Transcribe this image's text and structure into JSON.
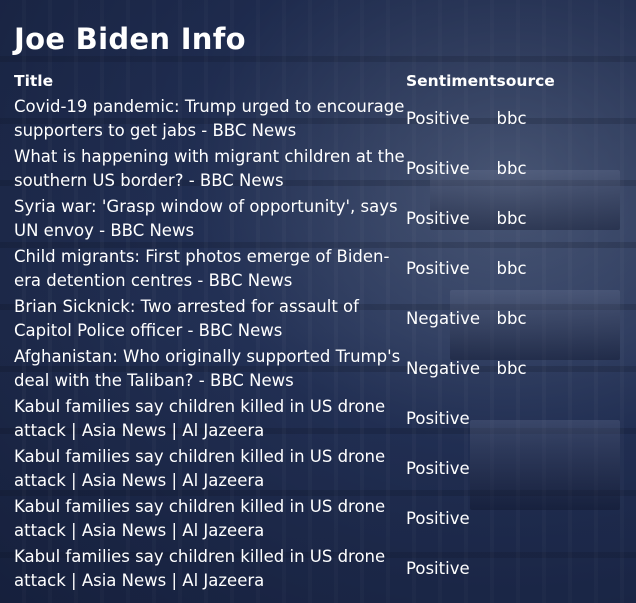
{
  "page": {
    "title": "Joe Biden Info"
  },
  "table": {
    "headers": {
      "title": "Title",
      "sentiment": "Sentiment",
      "source": "source"
    },
    "rows": [
      {
        "title": "Covid-19 pandemic: Trump urged to encourage supporters to get jabs - BBC News",
        "sentiment": "Positive",
        "source": "bbc"
      },
      {
        "title": "What is happening with migrant children at the southern US border? - BBC News",
        "sentiment": "Positive",
        "source": "bbc"
      },
      {
        "title": "Syria war: 'Grasp window of opportunity', says UN envoy - BBC News",
        "sentiment": "Positive",
        "source": "bbc"
      },
      {
        "title": "Child migrants: First photos emerge of Biden-era detention centres - BBC News",
        "sentiment": "Positive",
        "source": "bbc"
      },
      {
        "title": "Brian Sicknick: Two arrested for assault of Capitol Police officer - BBC News",
        "sentiment": "Negative",
        "source": "bbc"
      },
      {
        "title": "Afghanistan: Who originally supported Trump's deal with the Taliban? - BBC News",
        "sentiment": "Negative",
        "source": "bbc"
      },
      {
        "title": "Kabul families say children killed in US drone attack | Asia News | Al Jazeera",
        "sentiment": "Positive",
        "source": ""
      },
      {
        "title": "Kabul families say children killed in US drone attack | Asia News | Al Jazeera",
        "sentiment": "Positive",
        "source": ""
      },
      {
        "title": "Kabul families say children killed in US drone attack | Asia News | Al Jazeera",
        "sentiment": "Positive",
        "source": ""
      },
      {
        "title": "Kabul families say children killed in US drone attack | Asia News | Al Jazeera",
        "sentiment": "Positive",
        "source": ""
      }
    ]
  }
}
